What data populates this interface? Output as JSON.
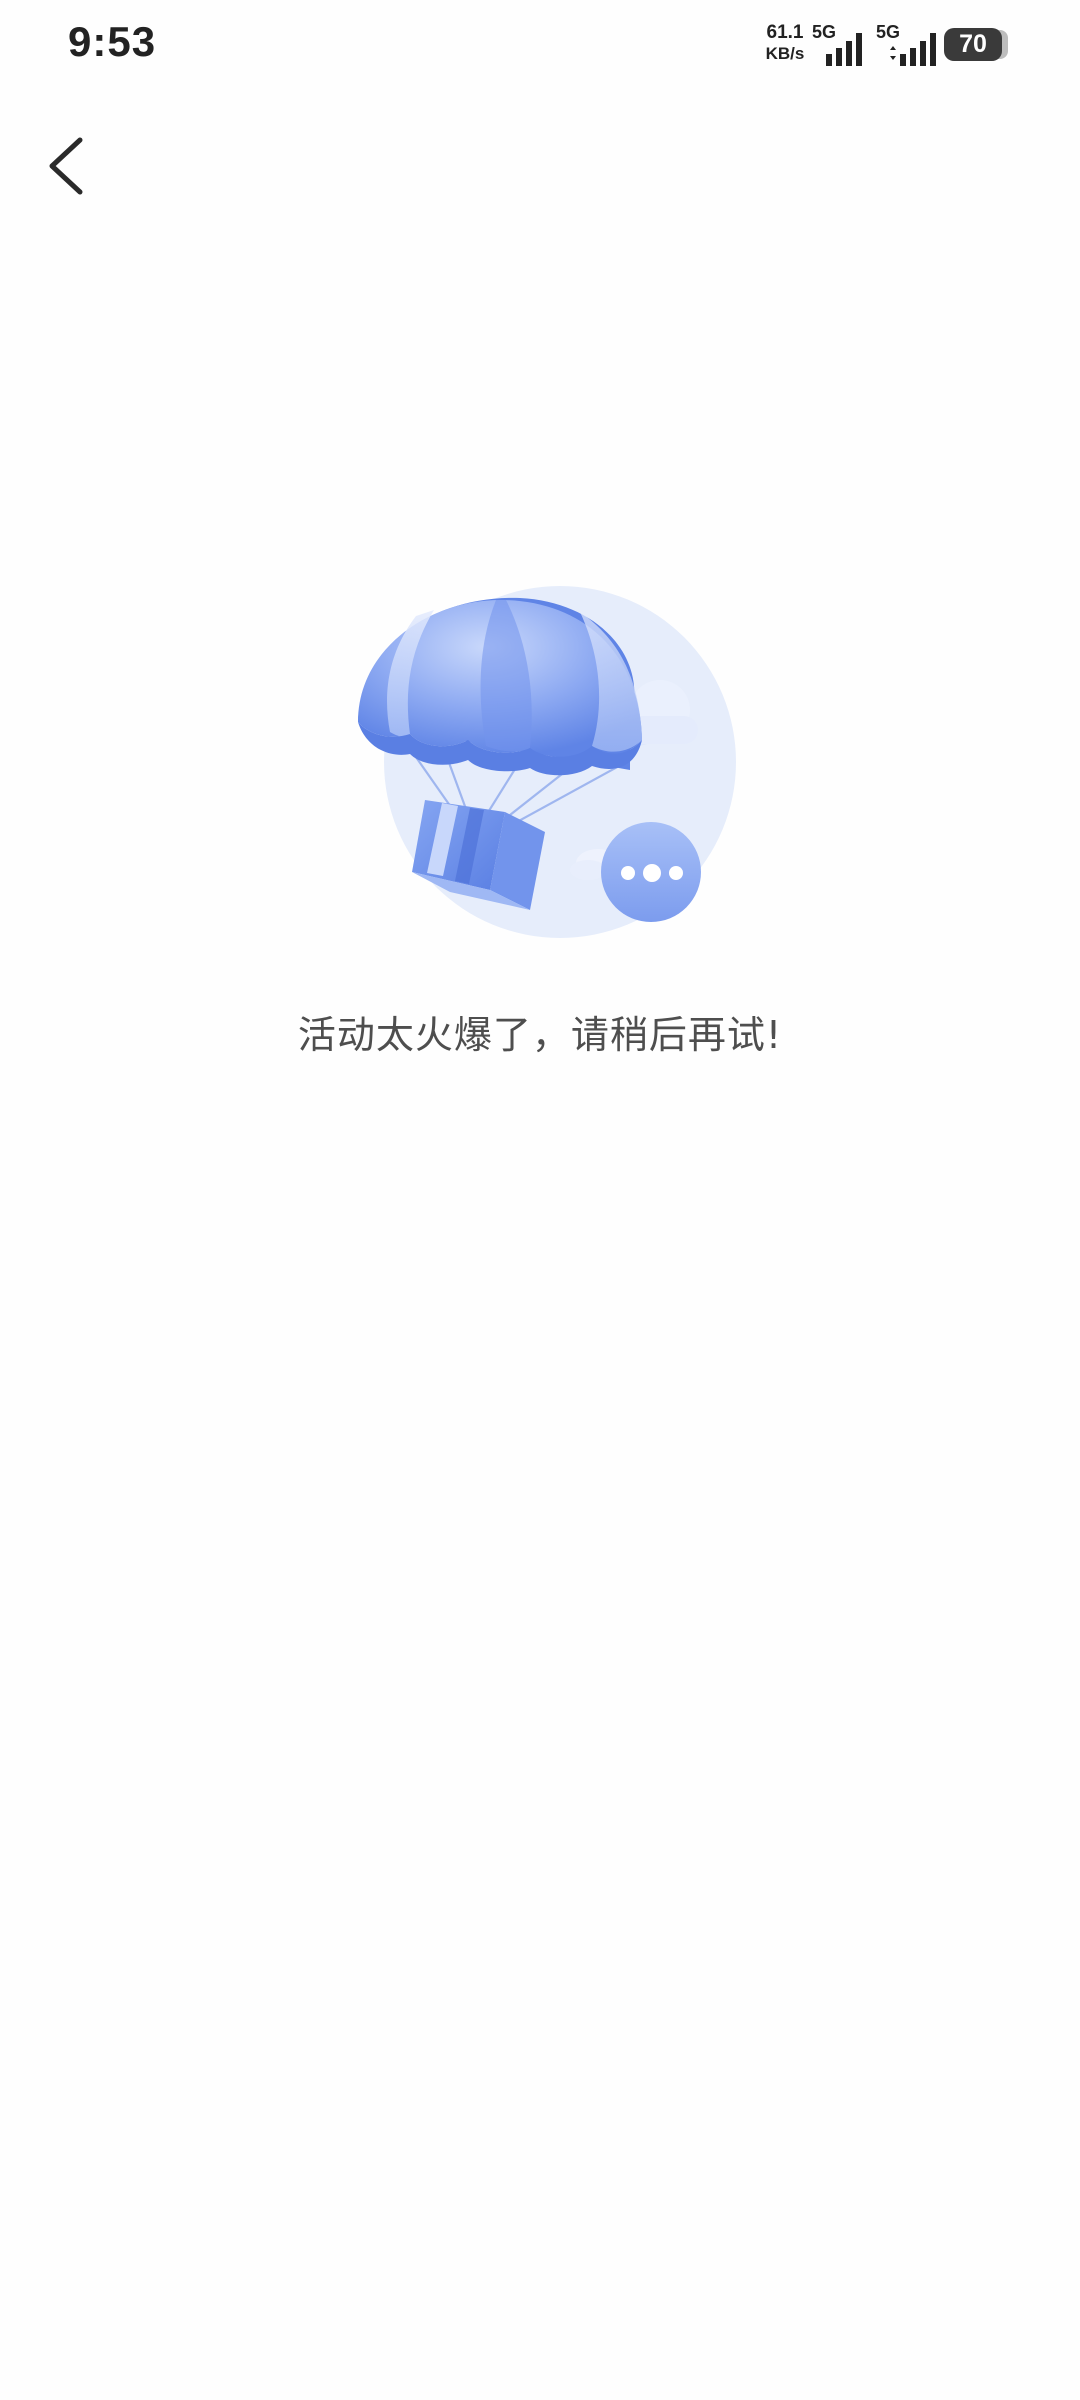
{
  "status_bar": {
    "time": "9:53",
    "net_speed_value": "61.1",
    "net_speed_unit": "KB/s",
    "sim1_tag": "5G",
    "sim2_tag": "5G",
    "battery_level": "70"
  },
  "header": {
    "back_icon": "chevron-left-icon"
  },
  "empty_state": {
    "illustration": "parachute-package-icon",
    "message": "活动太火爆了，请稍后再试!"
  },
  "colors": {
    "accent_blue": "#6f94ee",
    "light_blue": "#e6edfb",
    "text": "#4e4e4e"
  }
}
